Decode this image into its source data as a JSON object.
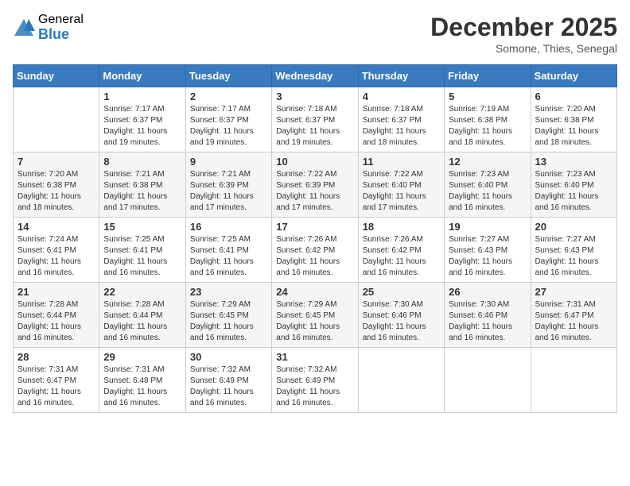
{
  "logo": {
    "general": "General",
    "blue": "Blue"
  },
  "header": {
    "month": "December 2025",
    "location": "Somone, Thies, Senegal"
  },
  "days_of_week": [
    "Sunday",
    "Monday",
    "Tuesday",
    "Wednesday",
    "Thursday",
    "Friday",
    "Saturday"
  ],
  "weeks": [
    [
      {
        "day": "",
        "info": ""
      },
      {
        "day": "1",
        "info": "Sunrise: 7:17 AM\nSunset: 6:37 PM\nDaylight: 11 hours and 19 minutes."
      },
      {
        "day": "2",
        "info": "Sunrise: 7:17 AM\nSunset: 6:37 PM\nDaylight: 11 hours and 19 minutes."
      },
      {
        "day": "3",
        "info": "Sunrise: 7:18 AM\nSunset: 6:37 PM\nDaylight: 11 hours and 19 minutes."
      },
      {
        "day": "4",
        "info": "Sunrise: 7:18 AM\nSunset: 6:37 PM\nDaylight: 11 hours and 18 minutes."
      },
      {
        "day": "5",
        "info": "Sunrise: 7:19 AM\nSunset: 6:38 PM\nDaylight: 11 hours and 18 minutes."
      },
      {
        "day": "6",
        "info": "Sunrise: 7:20 AM\nSunset: 6:38 PM\nDaylight: 11 hours and 18 minutes."
      }
    ],
    [
      {
        "day": "7",
        "info": "Sunrise: 7:20 AM\nSunset: 6:38 PM\nDaylight: 11 hours and 18 minutes."
      },
      {
        "day": "8",
        "info": "Sunrise: 7:21 AM\nSunset: 6:38 PM\nDaylight: 11 hours and 17 minutes."
      },
      {
        "day": "9",
        "info": "Sunrise: 7:21 AM\nSunset: 6:39 PM\nDaylight: 11 hours and 17 minutes."
      },
      {
        "day": "10",
        "info": "Sunrise: 7:22 AM\nSunset: 6:39 PM\nDaylight: 11 hours and 17 minutes."
      },
      {
        "day": "11",
        "info": "Sunrise: 7:22 AM\nSunset: 6:40 PM\nDaylight: 11 hours and 17 minutes."
      },
      {
        "day": "12",
        "info": "Sunrise: 7:23 AM\nSunset: 6:40 PM\nDaylight: 11 hours and 16 minutes."
      },
      {
        "day": "13",
        "info": "Sunrise: 7:23 AM\nSunset: 6:40 PM\nDaylight: 11 hours and 16 minutes."
      }
    ],
    [
      {
        "day": "14",
        "info": "Sunrise: 7:24 AM\nSunset: 6:41 PM\nDaylight: 11 hours and 16 minutes."
      },
      {
        "day": "15",
        "info": "Sunrise: 7:25 AM\nSunset: 6:41 PM\nDaylight: 11 hours and 16 minutes."
      },
      {
        "day": "16",
        "info": "Sunrise: 7:25 AM\nSunset: 6:41 PM\nDaylight: 11 hours and 16 minutes."
      },
      {
        "day": "17",
        "info": "Sunrise: 7:26 AM\nSunset: 6:42 PM\nDaylight: 11 hours and 16 minutes."
      },
      {
        "day": "18",
        "info": "Sunrise: 7:26 AM\nSunset: 6:42 PM\nDaylight: 11 hours and 16 minutes."
      },
      {
        "day": "19",
        "info": "Sunrise: 7:27 AM\nSunset: 6:43 PM\nDaylight: 11 hours and 16 minutes."
      },
      {
        "day": "20",
        "info": "Sunrise: 7:27 AM\nSunset: 6:43 PM\nDaylight: 11 hours and 16 minutes."
      }
    ],
    [
      {
        "day": "21",
        "info": "Sunrise: 7:28 AM\nSunset: 6:44 PM\nDaylight: 11 hours and 16 minutes."
      },
      {
        "day": "22",
        "info": "Sunrise: 7:28 AM\nSunset: 6:44 PM\nDaylight: 11 hours and 16 minutes."
      },
      {
        "day": "23",
        "info": "Sunrise: 7:29 AM\nSunset: 6:45 PM\nDaylight: 11 hours and 16 minutes."
      },
      {
        "day": "24",
        "info": "Sunrise: 7:29 AM\nSunset: 6:45 PM\nDaylight: 11 hours and 16 minutes."
      },
      {
        "day": "25",
        "info": "Sunrise: 7:30 AM\nSunset: 6:46 PM\nDaylight: 11 hours and 16 minutes."
      },
      {
        "day": "26",
        "info": "Sunrise: 7:30 AM\nSunset: 6:46 PM\nDaylight: 11 hours and 16 minutes."
      },
      {
        "day": "27",
        "info": "Sunrise: 7:31 AM\nSunset: 6:47 PM\nDaylight: 11 hours and 16 minutes."
      }
    ],
    [
      {
        "day": "28",
        "info": "Sunrise: 7:31 AM\nSunset: 6:47 PM\nDaylight: 11 hours and 16 minutes."
      },
      {
        "day": "29",
        "info": "Sunrise: 7:31 AM\nSunset: 6:48 PM\nDaylight: 11 hours and 16 minutes."
      },
      {
        "day": "30",
        "info": "Sunrise: 7:32 AM\nSunset: 6:49 PM\nDaylight: 11 hours and 16 minutes."
      },
      {
        "day": "31",
        "info": "Sunrise: 7:32 AM\nSunset: 6:49 PM\nDaylight: 11 hours and 16 minutes."
      },
      {
        "day": "",
        "info": ""
      },
      {
        "day": "",
        "info": ""
      },
      {
        "day": "",
        "info": ""
      }
    ]
  ]
}
